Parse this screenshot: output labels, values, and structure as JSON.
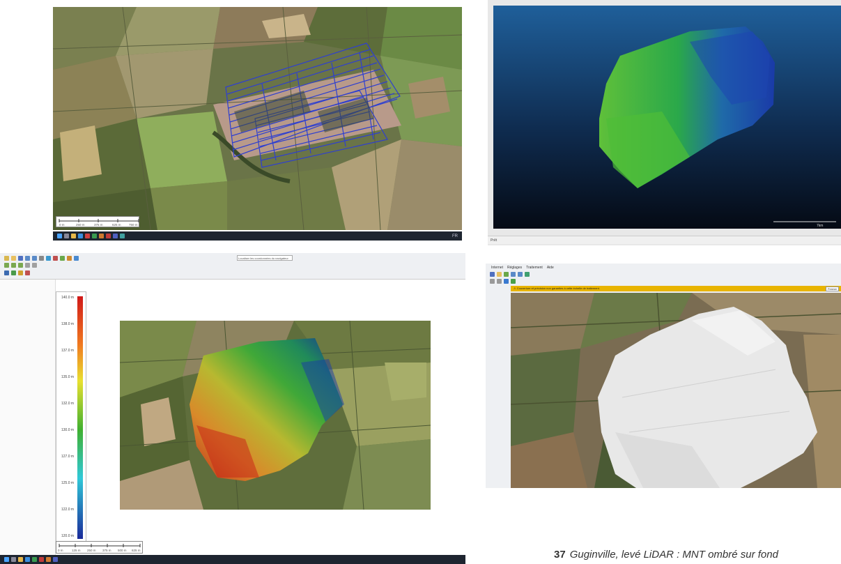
{
  "panel1": {
    "scale_labels": [
      "0 m",
      "250 m",
      "375 m",
      "625 m",
      "750 m"
    ],
    "tray_text": "FR"
  },
  "panel2": {
    "status_text": "Prêt",
    "scale_value": "7km"
  },
  "panel3": {
    "legend_values": [
      "140.0 m",
      "138.0 m",
      "137.0 m",
      "135.0 m",
      "132.0 m",
      "130.0 m",
      "127.0 m",
      "125.0 m",
      "122.0 m",
      "120.0 m"
    ],
    "scale_labels": [
      "0 m",
      "125 m",
      "250 m",
      "375 m",
      "500 m",
      "625 m"
    ],
    "search_label": "Localiser les coordonnées du navigateur"
  },
  "panel4": {
    "menu_items": [
      "Internet",
      "Réglages",
      "Traitement",
      "Aide"
    ],
    "warning_text": "Couverture et précision non garanties à cette échelle de traitement.",
    "close_label": "Fermer"
  },
  "caption": {
    "number": "37",
    "text": "Guginville, levé LiDAR : MNT ombré sur fond"
  },
  "colors": {
    "flight_lines": "#2e3fd0",
    "warning_bar": "#e8b400",
    "taskbar": "#1e2530"
  }
}
